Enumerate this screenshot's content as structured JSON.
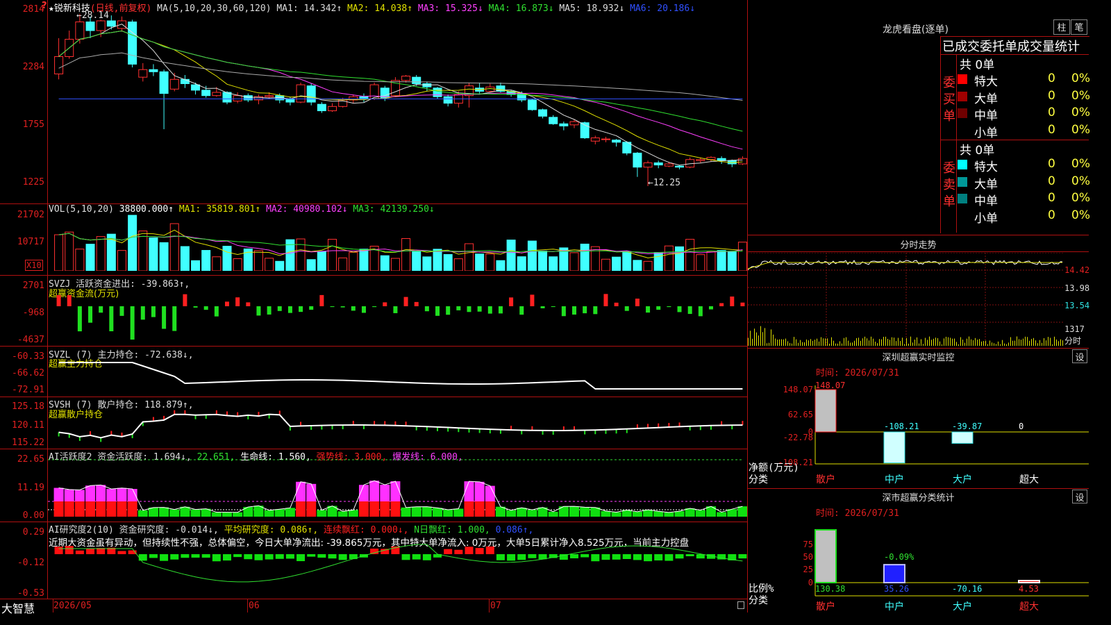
{
  "stock": {
    "name": "锐新科技",
    "period": "(日线,前复权)",
    "star": "★"
  },
  "price_axis": [
    "2814",
    "2284",
    "1755",
    "1225"
  ],
  "ma_header": {
    "prefix": "MA(5,10,20,30,60,120)",
    "ma1": "MA1: 14.342↑",
    "ma2": "MA2: 14.038↑",
    "ma3": "MA3: 15.325↓",
    "ma4": "MA4: 16.873↓",
    "ma5": "MA5: 18.932↓",
    "ma6": "MA6: 20.186↓"
  },
  "price_marks": {
    "high": "28.14",
    "low": "12.25",
    "high_arrow": "←28.14",
    "low_arrow": "←12.25"
  },
  "vol": {
    "axis": [
      "21702",
      "10717"
    ],
    "unit": "X10",
    "header_prefix": "VOL(5,10,20)",
    "value": "38800.000↑",
    "ma1": "MA1: 35819.801↑",
    "ma2": "MA2: 40980.102↓",
    "ma3": "MA3: 42139.250↓"
  },
  "svzj": {
    "axis": [
      "2701",
      "-968",
      "-4637"
    ],
    "line1": "SVZJ  活跃资金进出: -39.863↑,",
    "line2": "超赢资金流(万元)"
  },
  "svzl": {
    "axis": [
      "-60.33",
      "-66.62",
      "-72.91"
    ],
    "line1": "SVZL (7) 主力持仓: -72.638↓,",
    "line2": "超赢主力持仓"
  },
  "svsh": {
    "axis": [
      "125.18",
      "120.11",
      "115.22"
    ],
    "line1": "SVSH (7) 散户持仓: 118.879↑,",
    "line2": "超赢散户持仓"
  },
  "ai1": {
    "axis": [
      "22.65",
      "11.19",
      "0.00"
    ],
    "title": "AI活跃度2 资金活跃度: 1.694↓,",
    "v2": "22.651,",
    "life": "生命线: 1.560,",
    "strong": "强势线: 3.000,",
    "burst": "爆发线: 6.000,"
  },
  "ai2": {
    "axis": [
      "0.29",
      "-0.12",
      "-0.53"
    ],
    "title": "AI研究度2(10) 资金研究度: -0.014↓,",
    "avg": "平均研究度: 0.086↑,",
    "streak": "连续飘红: 0.000↓,",
    "nday": "N日飘红: 1.000,",
    "extra": "0.086↑,",
    "comment": "近期大资金虽有异动，但持续性不强，总体偏空，今日大单净流出: -39.865万元，其中特大单净流入: 0万元，大单5日累计净入8.525万元，当前主力控盘"
  },
  "footer": {
    "brand": "大智慧",
    "dates": [
      "2026/05",
      "06",
      "07"
    ]
  },
  "right": {
    "dragon_title": "龙虎看盘(逐单)",
    "btn_zhu": "柱",
    "btn_bi": "笔",
    "section_title": "已成交委托单成交量统计",
    "buy_label": "委买单",
    "sell_label": "委卖单",
    "buy_total": "共 0单",
    "sell_total": "共 0单",
    "buy_rows": [
      {
        "name": "特大",
        "count": "0",
        "pct": "0%",
        "color": "#ff0000"
      },
      {
        "name": "大单",
        "count": "0",
        "pct": "0%",
        "color": "#a00000"
      },
      {
        "name": "中单",
        "count": "0",
        "pct": "0%",
        "color": "#700000"
      },
      {
        "name": "小单",
        "count": "0",
        "pct": "0%",
        "color": "#000000"
      }
    ],
    "sell_rows": [
      {
        "name": "特大",
        "count": "0",
        "pct": "0%",
        "color": "#00ffff"
      },
      {
        "name": "大单",
        "count": "0",
        "pct": "0%",
        "color": "#009999"
      },
      {
        "name": "中单",
        "count": "0",
        "pct": "0%",
        "color": "#008080"
      },
      {
        "name": "小单",
        "count": "0",
        "pct": "0%",
        "color": "#000000"
      }
    ],
    "intraday_title": "分时走势",
    "intraday_axis": [
      "14.42",
      "13.98",
      "13.54",
      "1317",
      "分时"
    ],
    "monitor_title": "深圳超赢实时监控",
    "monitor_btn": "设",
    "monitor_time": "时间: 2026/07/31",
    "monitor_axis": [
      "148.07",
      "62.65",
      "0",
      "-22.78",
      "-108.21"
    ],
    "monitor_ylabel": "净额(万元)",
    "monitor_xlabel": "分类",
    "monitor_values": [
      "148.07",
      "-108.21",
      "-39.87",
      "0"
    ],
    "categories": [
      "散户",
      "中户",
      "大户",
      "超大"
    ],
    "stats_title": "深市超赢分类统计",
    "stats_btn": "设",
    "stats_time": "时间: 2026/07/31",
    "stats_axis": [
      "75",
      "50",
      "25",
      "0"
    ],
    "stats_ylabel": "比例%",
    "stats_xlabel": "分类",
    "stats_pct_label": "-0.09%",
    "stats_values": [
      "130.38",
      "35.26",
      "-70.16",
      "4.53"
    ]
  },
  "chart_data": {
    "type": "candlestick",
    "title": "锐新科技 (日线,前复权)",
    "ylim": [
      12.25,
      28.14
    ],
    "x": [
      "2026/05",
      "06",
      "07"
    ],
    "candles": [
      [
        22.6,
        24.2,
        25.9,
        22.1
      ],
      [
        24.2,
        25.8,
        26.6,
        24.0
      ],
      [
        25.8,
        27.4,
        28.14,
        25.4
      ],
      [
        27.4,
        26.6,
        27.9,
        25.9
      ],
      [
        26.6,
        27.5,
        27.6,
        26.0
      ],
      [
        27.5,
        27.0,
        28.0,
        26.7
      ],
      [
        26.8,
        27.5,
        27.9,
        26.5
      ],
      [
        27.4,
        23.5,
        27.6,
        23.2
      ],
      [
        22.3,
        23.0,
        23.6,
        21.9
      ],
      [
        23.0,
        22.8,
        23.5,
        22.4
      ],
      [
        22.8,
        20.8,
        23.0,
        17.5
      ],
      [
        21.2,
        22.1,
        22.7,
        21.0
      ],
      [
        22.1,
        21.7,
        22.5,
        21.3
      ],
      [
        21.6,
        21.1,
        21.8,
        20.7
      ],
      [
        21.1,
        20.6,
        21.5,
        20.4
      ],
      [
        20.6,
        20.9,
        21.4,
        20.5
      ],
      [
        20.9,
        20.0,
        21.0,
        19.8
      ],
      [
        20.1,
        20.6,
        20.9,
        19.9
      ],
      [
        20.6,
        20.2,
        20.8,
        20.0
      ],
      [
        20.2,
        20.5,
        20.7,
        19.8
      ],
      [
        20.5,
        20.6,
        20.9,
        20.3
      ],
      [
        20.6,
        20.2,
        20.8,
        19.9
      ],
      [
        20.3,
        20.0,
        20.5,
        19.7
      ],
      [
        20.0,
        21.6,
        21.8,
        19.9
      ],
      [
        21.5,
        20.0,
        21.7,
        19.7
      ],
      [
        19.8,
        19.2,
        20.0,
        19.0
      ],
      [
        19.2,
        19.6,
        19.9,
        19.1
      ],
      [
        19.6,
        20.2,
        20.4,
        19.5
      ],
      [
        20.2,
        20.5,
        20.7,
        19.9
      ],
      [
        20.5,
        20.3,
        20.8,
        20.0
      ],
      [
        20.3,
        21.6,
        21.8,
        20.2
      ],
      [
        21.3,
        20.4,
        21.5,
        20.1
      ],
      [
        20.6,
        22.0,
        22.3,
        20.5
      ],
      [
        22.0,
        22.4,
        22.5,
        21.8
      ],
      [
        22.3,
        21.7,
        22.5,
        21.5
      ],
      [
        21.7,
        21.4,
        21.9,
        21.0
      ],
      [
        21.3,
        20.5,
        21.4,
        20.3
      ],
      [
        20.5,
        19.9,
        20.7,
        19.6
      ],
      [
        19.9,
        20.7,
        21.0,
        19.5
      ],
      [
        20.6,
        21.5,
        21.8,
        19.5
      ],
      [
        21.3,
        21.0,
        21.8,
        20.8
      ],
      [
        21.0,
        21.4,
        21.7,
        20.9
      ],
      [
        21.5,
        21.0,
        21.8,
        20.9
      ],
      [
        21.0,
        20.7,
        21.1,
        20.5
      ],
      [
        20.8,
        20.2,
        21.0,
        20.0
      ],
      [
        20.2,
        19.3,
        20.3,
        19.2
      ],
      [
        19.3,
        18.7,
        19.4,
        18.5
      ],
      [
        18.6,
        18.0,
        18.8,
        17.9
      ],
      [
        18.0,
        17.8,
        18.2,
        17.4
      ],
      [
        17.9,
        18.2,
        18.4,
        17.6
      ],
      [
        18.1,
        16.7,
        18.2,
        16.6
      ],
      [
        16.4,
        16.7,
        16.9,
        16.1
      ],
      [
        16.6,
        16.6,
        16.8,
        16.3
      ],
      [
        16.5,
        16.3,
        16.6,
        15.9
      ],
      [
        16.3,
        15.3,
        16.4,
        15.1
      ],
      [
        15.3,
        14.0,
        15.4,
        13.1
      ],
      [
        14.0,
        14.4,
        14.6,
        12.25
      ],
      [
        14.4,
        14.2,
        14.6,
        13.9
      ],
      [
        14.1,
        14.3,
        14.5,
        14.0
      ],
      [
        14.1,
        14.0,
        14.2,
        13.8
      ],
      [
        14.0,
        14.7,
        14.9,
        13.9
      ],
      [
        14.6,
        14.7,
        14.9,
        14.4
      ],
      [
        14.7,
        14.9,
        15.0,
        14.5
      ],
      [
        14.8,
        14.6,
        15.0,
        14.3
      ],
      [
        14.6,
        14.3,
        14.7,
        14.0
      ],
      [
        14.3,
        14.8,
        15.0,
        14.2
      ]
    ]
  }
}
